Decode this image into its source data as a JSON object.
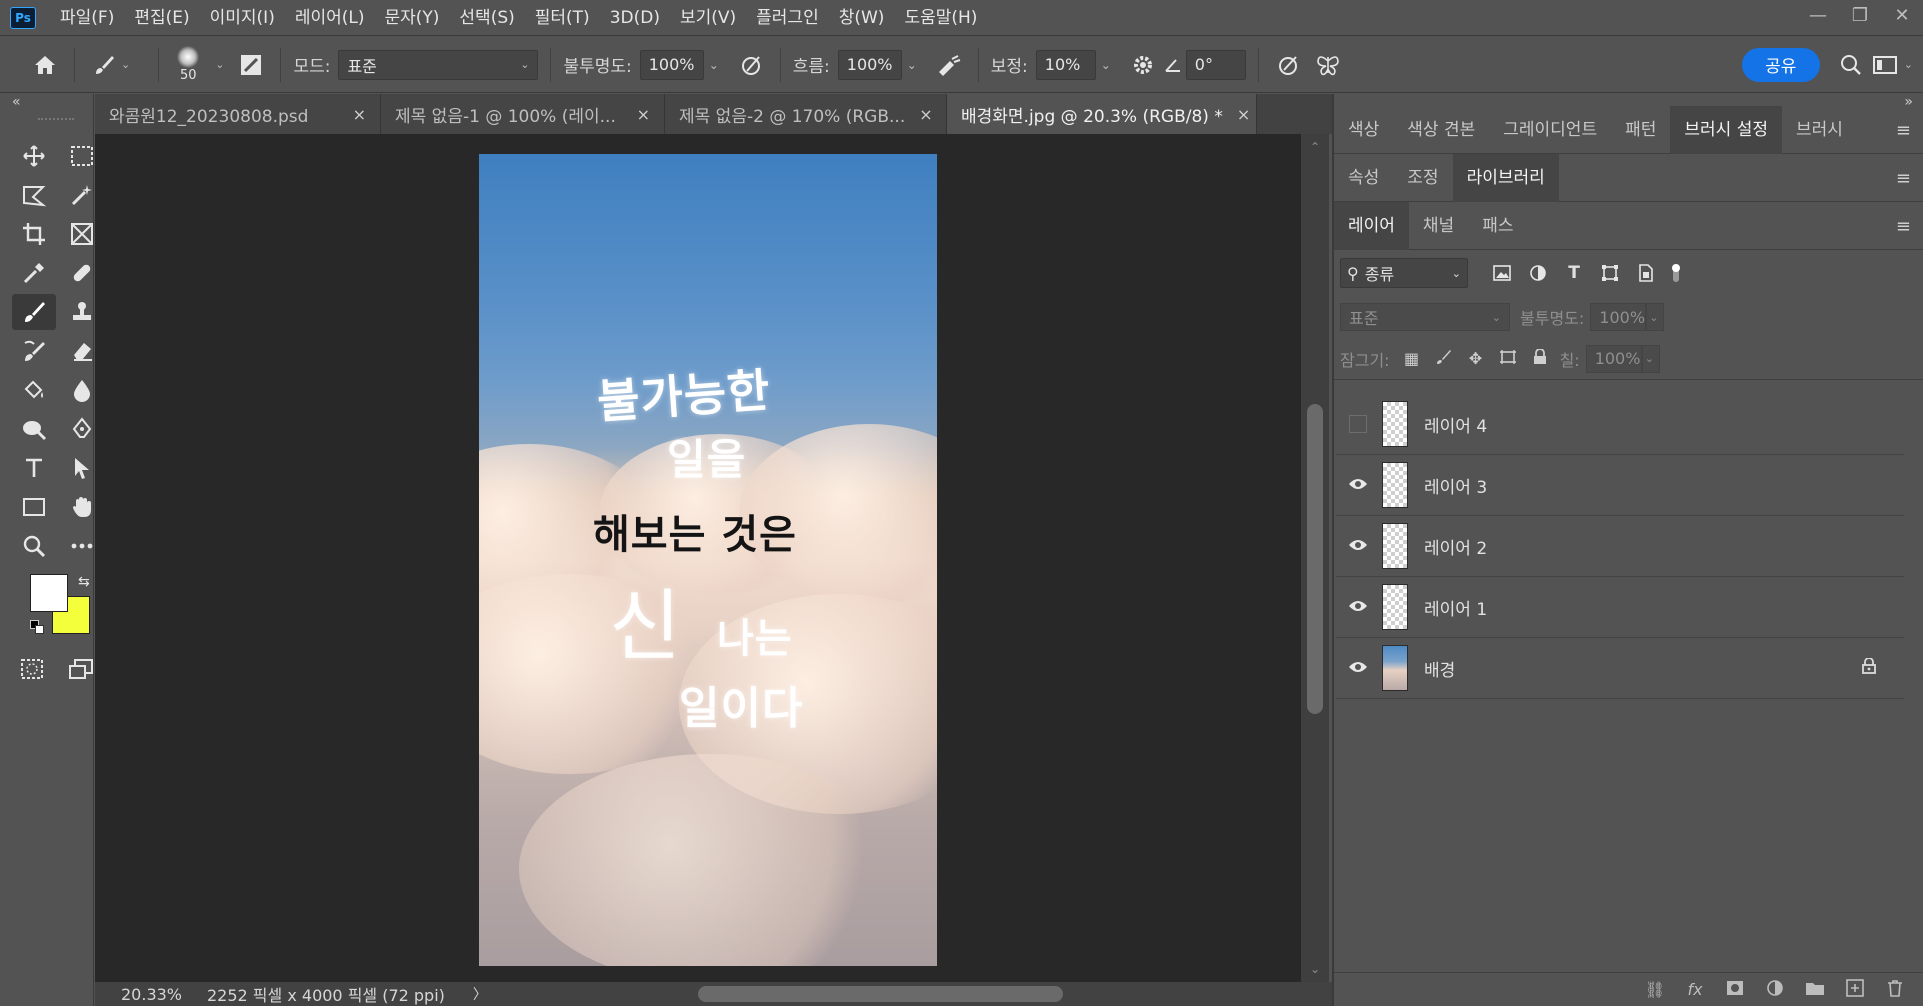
{
  "app": {
    "logo": "Ps"
  },
  "menu": [
    "파일(F)",
    "편집(E)",
    "이미지(I)",
    "레이어(L)",
    "문자(Y)",
    "선택(S)",
    "필터(T)",
    "3D(D)",
    "보기(V)",
    "플러그인",
    "창(W)",
    "도움말(H)"
  ],
  "window_controls": {
    "minimize": "—",
    "restore": "❐",
    "close": "✕"
  },
  "options": {
    "brush_size": "50",
    "mode_label": "모드:",
    "mode_value": "표준",
    "opacity_label": "불투명도:",
    "opacity_value": "100%",
    "flow_label": "흐름:",
    "flow_value": "100%",
    "smoothing_label": "보정:",
    "smoothing_value": "10%",
    "angle_value": "0°",
    "share_label": "공유"
  },
  "tabs": [
    {
      "label": "와콤원12_20230808.psd",
      "active": false
    },
    {
      "label": "제목 없음-1 @ 100% (레이...",
      "active": false
    },
    {
      "label": "제목 없음-2 @ 170% (RGB...",
      "active": false
    },
    {
      "label": "배경화면.jpg @ 20.3% (RGB/8) *",
      "active": true
    }
  ],
  "tab_close": "×",
  "canvas_text": {
    "line1": "불가능한",
    "line2": "일을",
    "line3": "해보는 것은",
    "line4a": "신",
    "line4b": "나는",
    "line5": "일이다"
  },
  "status": {
    "zoom": "20.33%",
    "doc_info": "2252 픽셀 x 4000 픽셀 (72 ppi)",
    "arrow": "〉"
  },
  "panels": {
    "row1_tabs": [
      "색상",
      "색상 견본",
      "그레이디언트",
      "패턴",
      "브러시 설정",
      "브러시"
    ],
    "row1_active": "브러시 설정",
    "row2_tabs": [
      "속성",
      "조정",
      "라이브러리"
    ],
    "row2_active": "라이브러리",
    "row3_tabs": [
      "레이어",
      "채널",
      "패스"
    ],
    "row3_active": "레이어",
    "menu_icon": "≡"
  },
  "layers_panel": {
    "kind_label": "종류",
    "blend_value": "표준",
    "opacity_label": "불투명도:",
    "opacity_value": "100%",
    "lock_label": "잠그기:",
    "fill_label": "칠:",
    "fill_value": "100%"
  },
  "layers": [
    {
      "name": "레이어 4",
      "visible": false,
      "locked": false,
      "type": "transparent"
    },
    {
      "name": "레이어 3",
      "visible": true,
      "locked": false,
      "type": "transparent"
    },
    {
      "name": "레이어 2",
      "visible": true,
      "locked": false,
      "type": "transparent"
    },
    {
      "name": "레이어 1",
      "visible": true,
      "locked": false,
      "type": "transparent"
    },
    {
      "name": "배경",
      "visible": true,
      "locked": true,
      "type": "image"
    }
  ],
  "colors": {
    "foreground": "#ffffff",
    "background": "#f2ff3a",
    "accent": "#1473e6"
  }
}
